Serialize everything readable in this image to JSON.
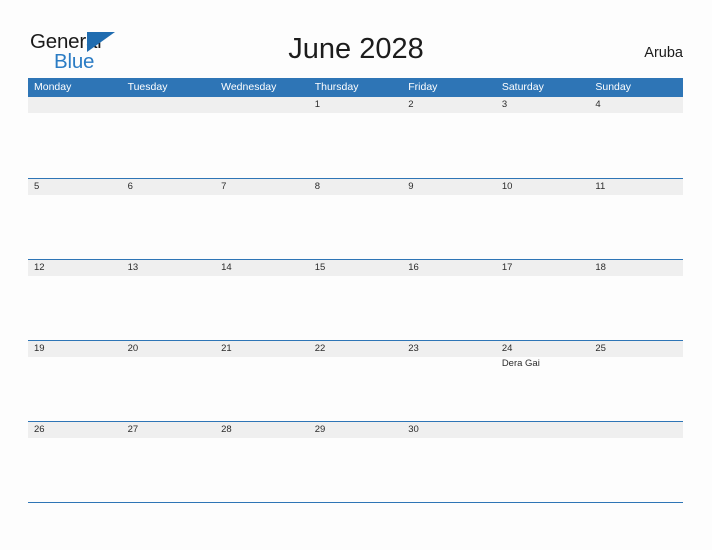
{
  "brand": {
    "name_part1": "General",
    "name_part2": "Blue",
    "triangle_icon": "triangle-icon",
    "color_dark": "#1a1a1a",
    "color_blue": "#2b7cc4"
  },
  "header": {
    "title": "June 2028",
    "country": "Aruba"
  },
  "calendar": {
    "accent_color": "#2e75b6",
    "date_strip_color": "#efefef",
    "weekdays": [
      "Monday",
      "Tuesday",
      "Wednesday",
      "Thursday",
      "Friday",
      "Saturday",
      "Sunday"
    ],
    "weeks": [
      {
        "days": [
          {
            "number": "",
            "events": []
          },
          {
            "number": "",
            "events": []
          },
          {
            "number": "",
            "events": []
          },
          {
            "number": "1",
            "events": []
          },
          {
            "number": "2",
            "events": []
          },
          {
            "number": "3",
            "events": []
          },
          {
            "number": "4",
            "events": []
          }
        ]
      },
      {
        "days": [
          {
            "number": "5",
            "events": []
          },
          {
            "number": "6",
            "events": []
          },
          {
            "number": "7",
            "events": []
          },
          {
            "number": "8",
            "events": []
          },
          {
            "number": "9",
            "events": []
          },
          {
            "number": "10",
            "events": []
          },
          {
            "number": "11",
            "events": []
          }
        ]
      },
      {
        "days": [
          {
            "number": "12",
            "events": []
          },
          {
            "number": "13",
            "events": []
          },
          {
            "number": "14",
            "events": []
          },
          {
            "number": "15",
            "events": []
          },
          {
            "number": "16",
            "events": []
          },
          {
            "number": "17",
            "events": []
          },
          {
            "number": "18",
            "events": []
          }
        ]
      },
      {
        "days": [
          {
            "number": "19",
            "events": []
          },
          {
            "number": "20",
            "events": []
          },
          {
            "number": "21",
            "events": []
          },
          {
            "number": "22",
            "events": []
          },
          {
            "number": "23",
            "events": []
          },
          {
            "number": "24",
            "events": [
              "Dera Gai"
            ]
          },
          {
            "number": "25",
            "events": []
          }
        ]
      },
      {
        "days": [
          {
            "number": "26",
            "events": []
          },
          {
            "number": "27",
            "events": []
          },
          {
            "number": "28",
            "events": []
          },
          {
            "number": "29",
            "events": []
          },
          {
            "number": "30",
            "events": []
          },
          {
            "number": "",
            "events": []
          },
          {
            "number": "",
            "events": []
          }
        ]
      }
    ]
  }
}
